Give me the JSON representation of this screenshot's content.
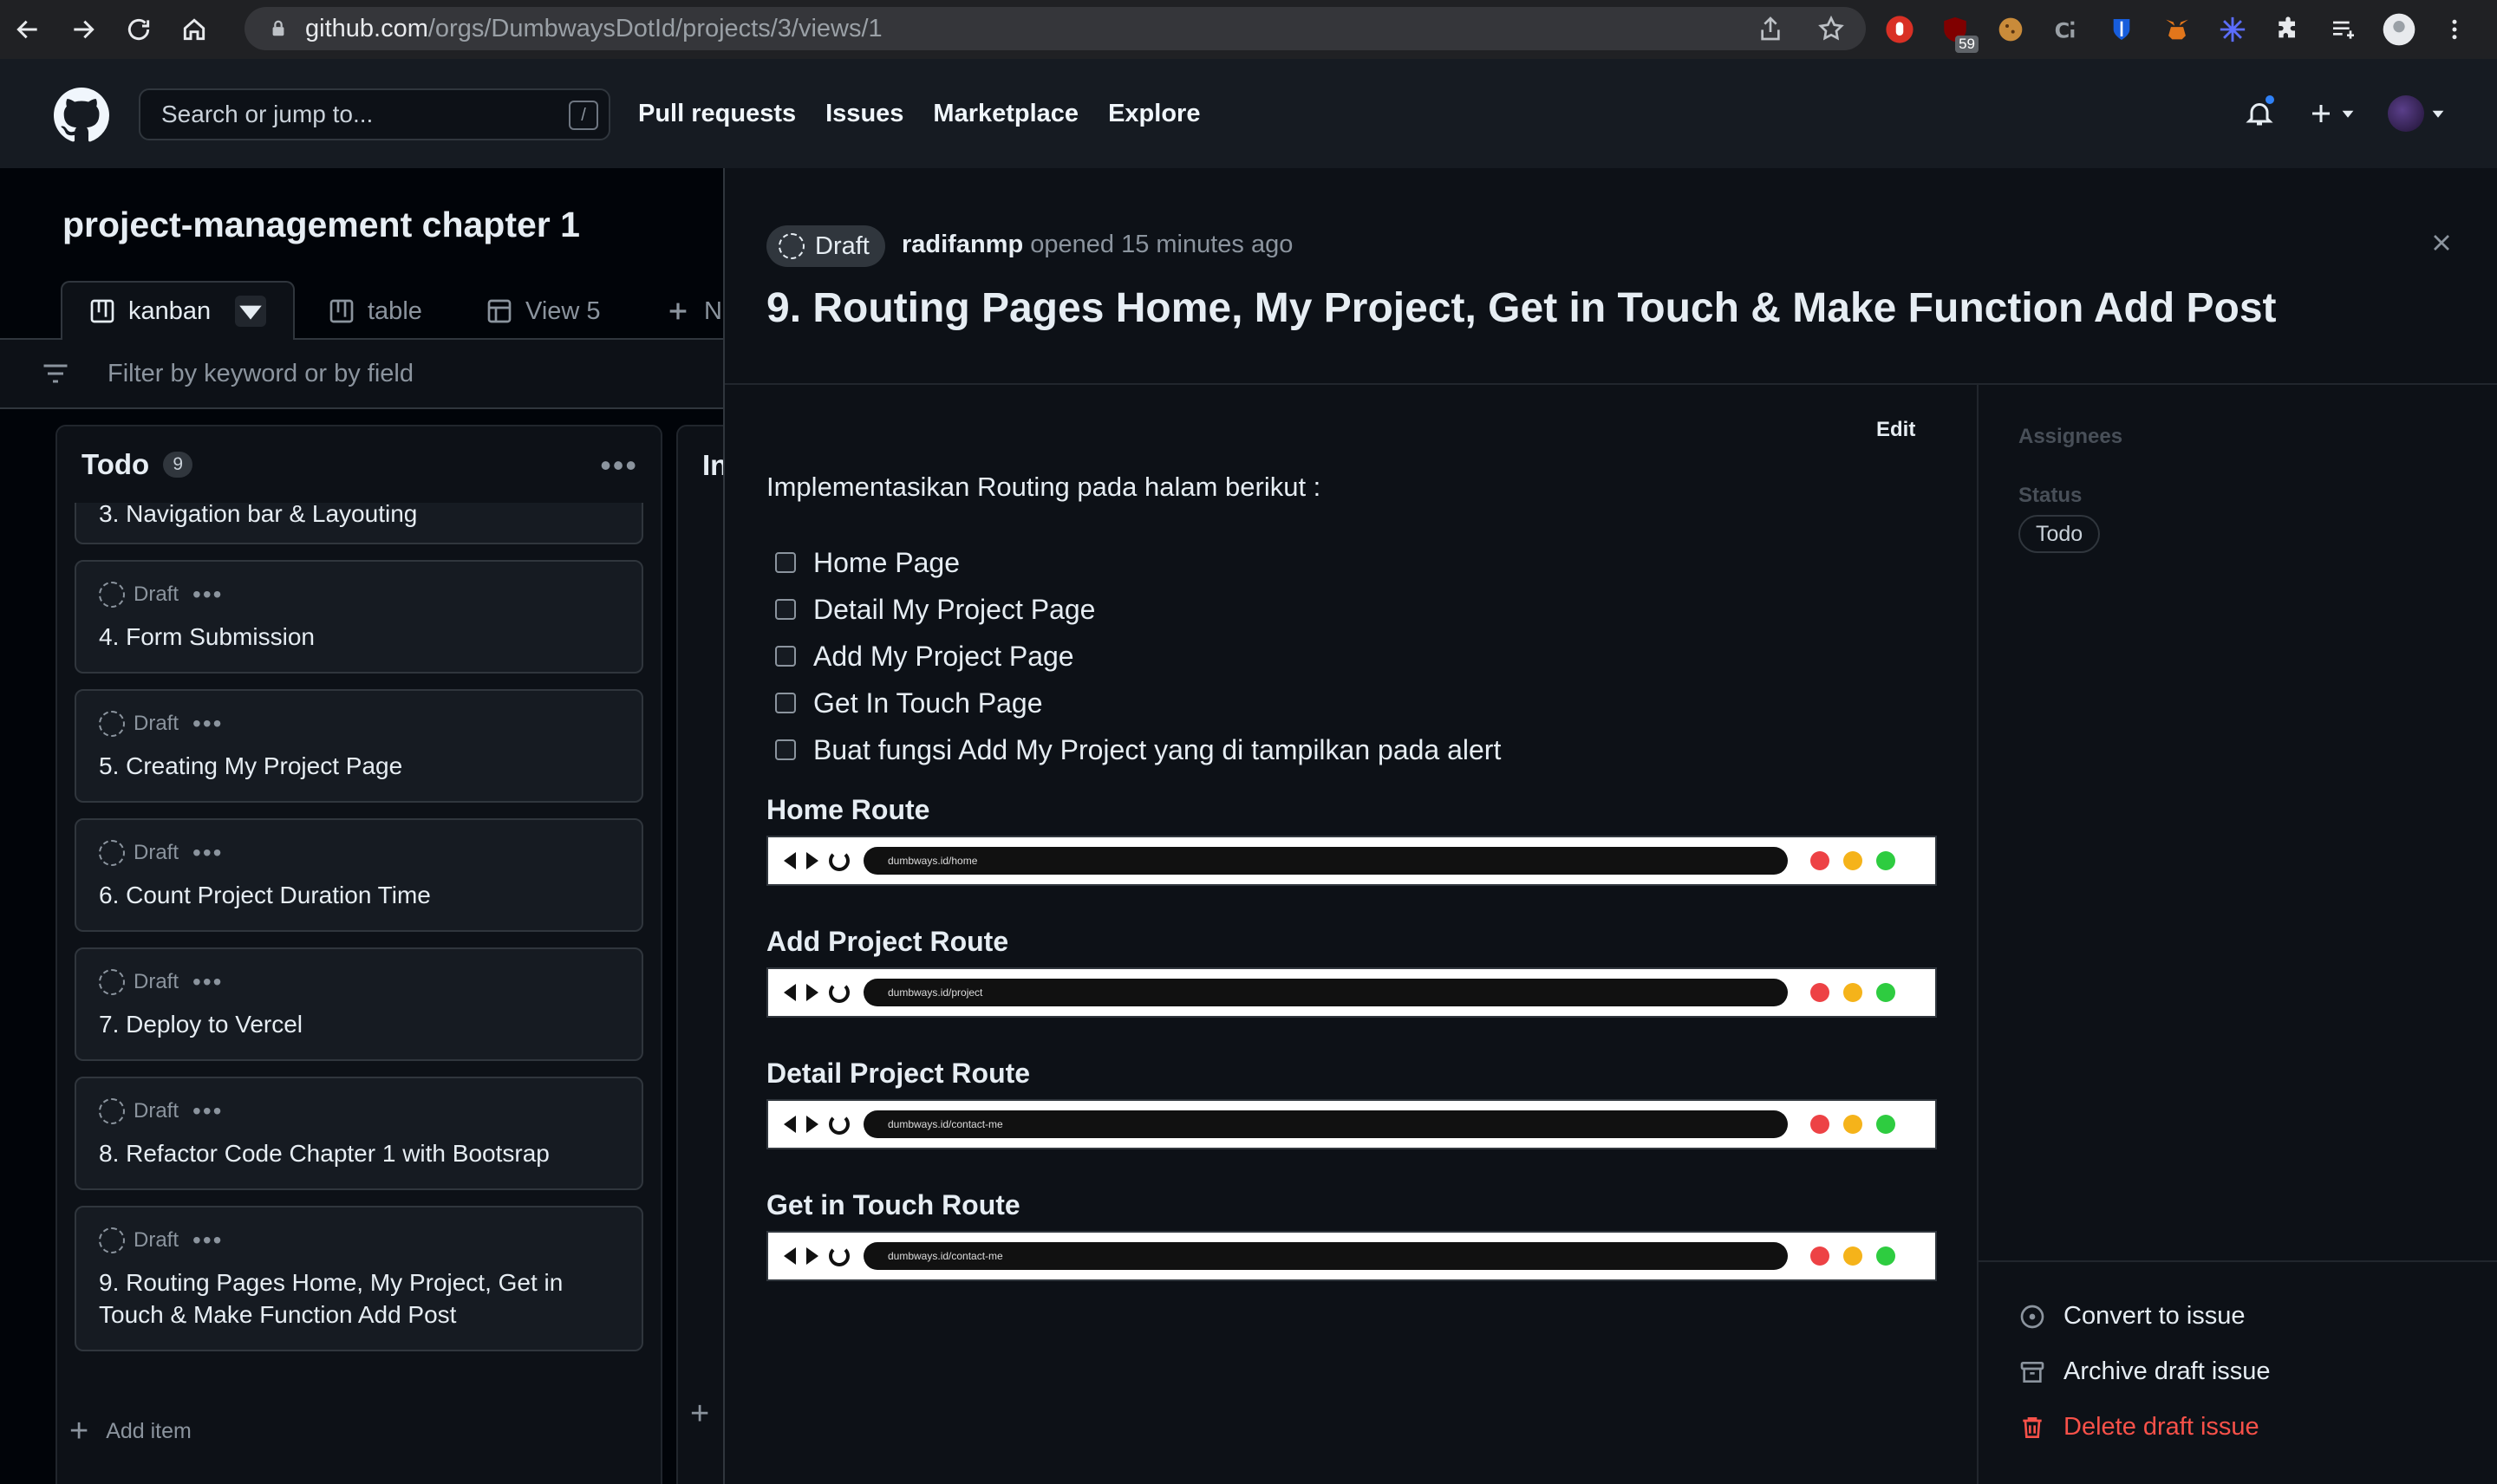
{
  "browser": {
    "url_host": "github.com",
    "url_path": "/orgs/DumbwaysDotId/projects/3/views/1",
    "extension_badge": "59"
  },
  "header": {
    "search_placeholder": "Search or jump to...",
    "search_shortcut": "/",
    "links": [
      "Pull requests",
      "Issues",
      "Marketplace",
      "Explore"
    ]
  },
  "board": {
    "title": "project-management chapter 1",
    "tabs": [
      {
        "label": "kanban",
        "icon": "board-icon"
      },
      {
        "label": "table",
        "icon": "board-icon"
      },
      {
        "label": "View 5",
        "icon": "table-icon"
      },
      {
        "label": "N",
        "icon": "plus-icon"
      }
    ],
    "filter_placeholder": "Filter by keyword or by field",
    "column": {
      "title": "Todo",
      "count": "9",
      "add_item_label": "Add item",
      "first_card": "3. Navigation bar & Layouting",
      "draft_label": "Draft",
      "cards": [
        "4. Form Submission",
        "5. Creating My Project Page",
        "6. Count Project Duration Time",
        "7. Deploy to Vercel",
        "8. Refactor Code Chapter 1 with Bootsrap",
        "9. Routing Pages Home, My Project, Get in Touch & Make Function Add Post"
      ]
    },
    "column2_label": "In"
  },
  "panel": {
    "draft_badge": "Draft",
    "author": "radifanmp",
    "opened_text": "opened 15 minutes ago",
    "title": "9. Routing Pages Home, My Project, Get in Touch & Make Function Add Post",
    "edit_label": "Edit",
    "intro": "Implementasikan Routing pada halam berikut :",
    "tasks": [
      "Home Page",
      "Detail My Project Page",
      "Add My Project Page",
      "Get In Touch Page",
      "Buat fungsi Add My Project yang di tampilkan pada alert"
    ],
    "routes": [
      {
        "heading": "Home Route",
        "url": "dumbways.id/home"
      },
      {
        "heading": "Add Project Route",
        "url": "dumbways.id/project"
      },
      {
        "heading": "Detail Project Route",
        "url": "dumbways.id/contact-me"
      },
      {
        "heading": "Get in Touch Route",
        "url": "dumbways.id/contact-me"
      }
    ],
    "sidebar": {
      "assignees_label": "Assignees",
      "status_label": "Status",
      "status_value": "Todo",
      "actions": {
        "convert": "Convert to issue",
        "archive": "Archive draft issue",
        "delete": "Delete draft issue"
      }
    }
  },
  "colors": {
    "traffic_red": "#ed4245",
    "traffic_yellow": "#f5b31a",
    "traffic_green": "#2ecc40",
    "danger": "#f85149",
    "notification_blue": "#2f81f7"
  }
}
